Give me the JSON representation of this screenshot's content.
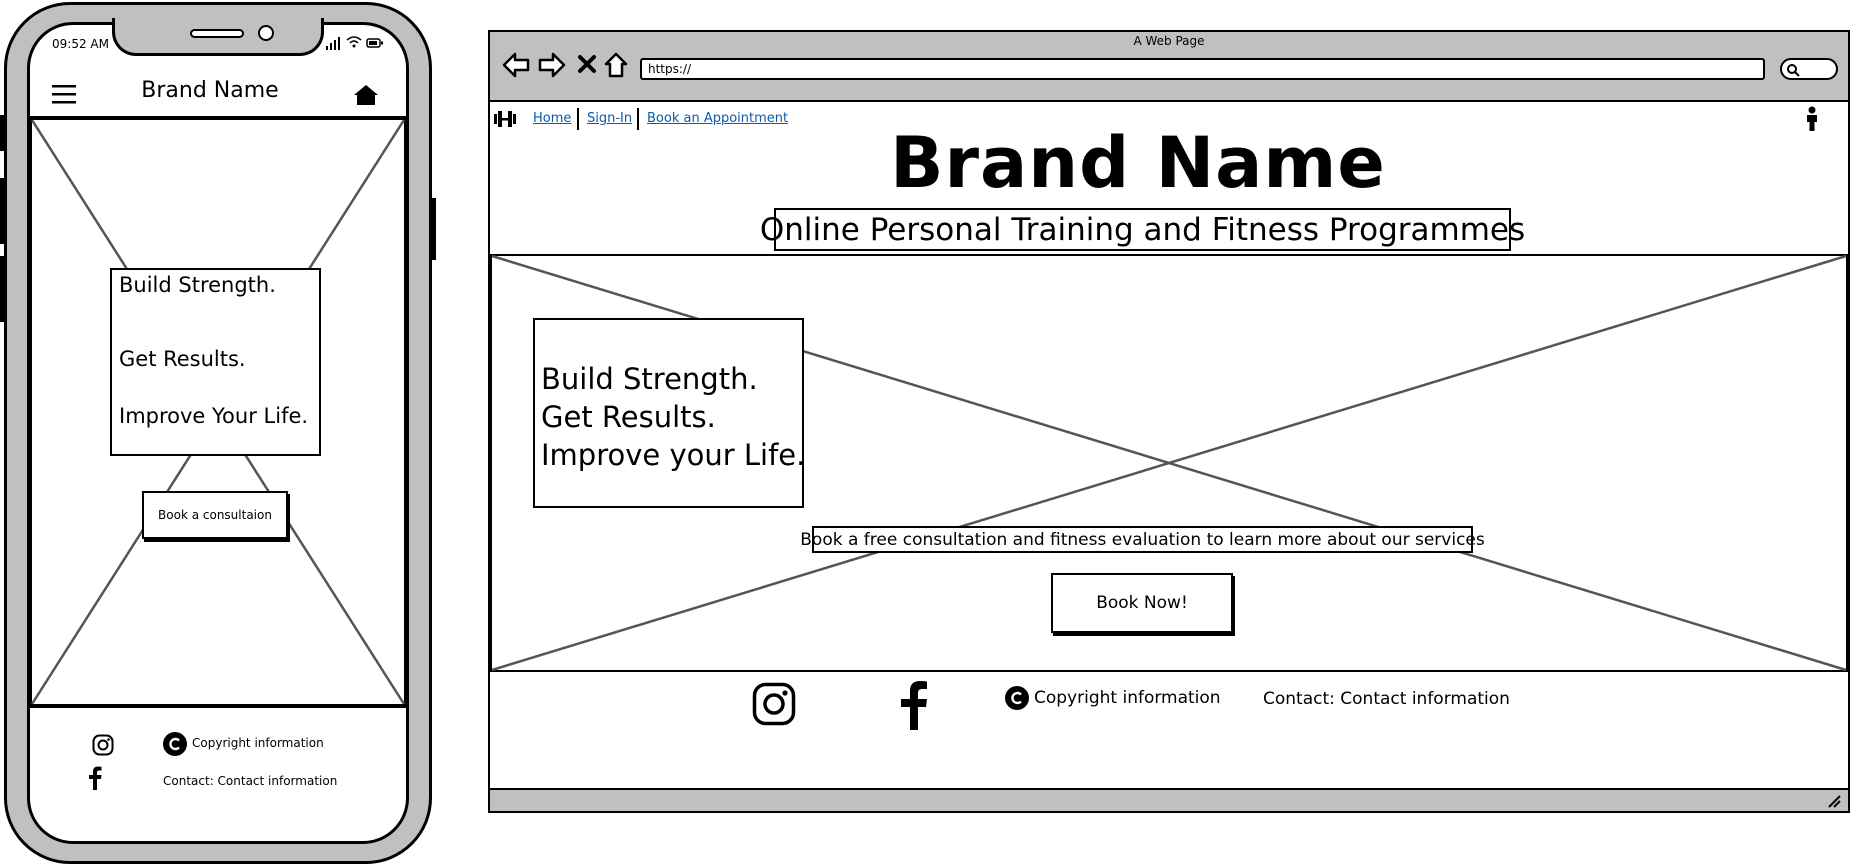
{
  "mobile": {
    "status_time": "09:52 AM",
    "brand": "Brand Name",
    "hero_lines": [
      "Build Strength.",
      "Get Results.",
      "Improve Your Life."
    ],
    "cta_label": "Book a consultaion",
    "copyright": "Copyright information",
    "contact": "Contact: Contact information"
  },
  "browser": {
    "window_title": "A Web Page",
    "url": "https://",
    "nav": [
      "Home",
      "Sign-In",
      "Book an Appointment"
    ],
    "brand": "Brand Name",
    "subtitle": "Online Personal Training and Fitness Programmes",
    "hero_lines": [
      "Build Strength.",
      "Get Results.",
      "Improve your Life."
    ],
    "consult_text": "Book a free consultation and fitness evaluation to learn more about our services",
    "cta_label": "Book Now!",
    "copyright": "Copyright information",
    "contact": "Contact: Contact information"
  },
  "colors": {
    "frame_gray": "#c0c0c0",
    "link": "#0b5cad"
  },
  "icons": [
    "hamburger-icon",
    "home-icon",
    "instagram-icon",
    "facebook-icon",
    "copyright-icon",
    "back-icon",
    "forward-icon",
    "stop-icon",
    "house-icon",
    "search-icon",
    "dumbbell-icon",
    "user-icon",
    "resize-grip-icon"
  ]
}
